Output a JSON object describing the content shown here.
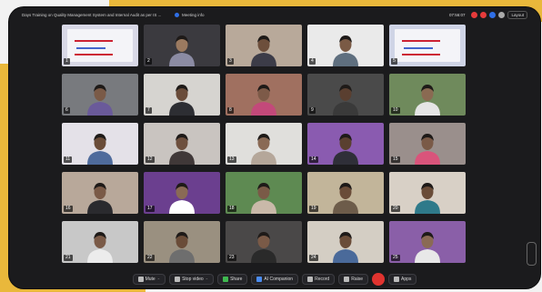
{
  "meeting": {
    "title": "Days Training on Quality Management System and Internal Audit as per IS ...",
    "info_label": "Meeting info",
    "clock": "07:56:07",
    "layout_label": "Layout"
  },
  "participants": [
    {
      "n": "1",
      "type": "slide",
      "bg": "#d8d8e6"
    },
    {
      "n": "2",
      "type": "person",
      "bg": "#3b3a3f",
      "skin": "#9b7a60",
      "shirt": "#8b8ba3"
    },
    {
      "n": "3",
      "type": "person",
      "bg": "#b8a99a",
      "skin": "#6d4f3c",
      "shirt": "#3c3c48"
    },
    {
      "n": "4",
      "type": "person",
      "bg": "#eaeaea",
      "skin": "#7a5a45",
      "shirt": "#5f6f7f"
    },
    {
      "n": "5",
      "type": "slide",
      "bg": "#cfd4e6"
    },
    {
      "n": "6",
      "type": "person",
      "bg": "#787a7e",
      "skin": "#7a5a47",
      "shirt": "#6a5a9a"
    },
    {
      "n": "7",
      "type": "person",
      "bg": "#d6d4d0",
      "skin": "#6a4c3a",
      "shirt": "#2d2e33"
    },
    {
      "n": "8",
      "type": "person",
      "bg": "#a07060",
      "skin": "#7d5a48",
      "shirt": "#c3497a"
    },
    {
      "n": "9",
      "type": "person",
      "bg": "#4a4a4a",
      "skin": "#5a3f30",
      "shirt": "#3a3a3a"
    },
    {
      "n": "10",
      "type": "person",
      "bg": "#6f8a5c",
      "skin": "#8a6a52",
      "shirt": "#e5e5e5"
    },
    {
      "n": "11",
      "type": "person",
      "bg": "#e4e1e8",
      "skin": "#6a4c38",
      "shirt": "#4f6b9c"
    },
    {
      "n": "12",
      "type": "person",
      "bg": "#c9c4c0",
      "skin": "#6e503e",
      "shirt": "#403838"
    },
    {
      "n": "13",
      "type": "person",
      "bg": "#e0dfdc",
      "skin": "#8a6a55",
      "shirt": "#b5a79a"
    },
    {
      "n": "14",
      "type": "person",
      "bg": "#8a5bb0",
      "skin": "#5a4030",
      "shirt": "#2f2f38"
    },
    {
      "n": "15",
      "type": "person",
      "bg": "#9a8f8c",
      "skin": "#7a5a47",
      "shirt": "#d9547b"
    },
    {
      "n": "16",
      "type": "person",
      "bg": "#b8a89a",
      "skin": "#7a5a47",
      "shirt": "#2a2a2e"
    },
    {
      "n": "17",
      "type": "person",
      "bg": "#6b3f8f",
      "skin": "#8a6a55",
      "shirt": "#ffffff"
    },
    {
      "n": "18",
      "type": "person",
      "bg": "#5e8a52",
      "skin": "#7a5a47",
      "shirt": "#c9b9a9"
    },
    {
      "n": "19",
      "type": "person",
      "bg": "#c2b59a",
      "skin": "#6a4c38",
      "shirt": "#6d5c4a"
    },
    {
      "n": "20",
      "type": "person",
      "bg": "#d8d0c6",
      "skin": "#6a4c38",
      "shirt": "#2f7a8a"
    },
    {
      "n": "21",
      "type": "person",
      "bg": "#c8c8c8",
      "skin": "#7a5a47",
      "shirt": "#ececec"
    },
    {
      "n": "22",
      "type": "person",
      "bg": "#9a9080",
      "skin": "#6a4c38",
      "shirt": "#6e6e6e"
    },
    {
      "n": "23",
      "type": "person",
      "bg": "#4a4848",
      "skin": "#7a5a47",
      "shirt": "#2a2a2a"
    },
    {
      "n": "24",
      "type": "person",
      "bg": "#d4cec4",
      "skin": "#6a4c38",
      "shirt": "#4a6a9a"
    },
    {
      "n": "25",
      "type": "person",
      "bg": "#8a5fa8",
      "skin": "#8a6a55",
      "shirt": "#e8e8e8"
    }
  ],
  "toolbar": {
    "mute": "Mute",
    "stop_video": "Stop video",
    "share": "Share",
    "ai_companion": "AI Companion",
    "record": "Record",
    "raise": "Raise",
    "apps": "Apps"
  },
  "colors": {
    "accent": "#e9b83b",
    "window": "#1b1b1d",
    "end": "#e0332f"
  }
}
